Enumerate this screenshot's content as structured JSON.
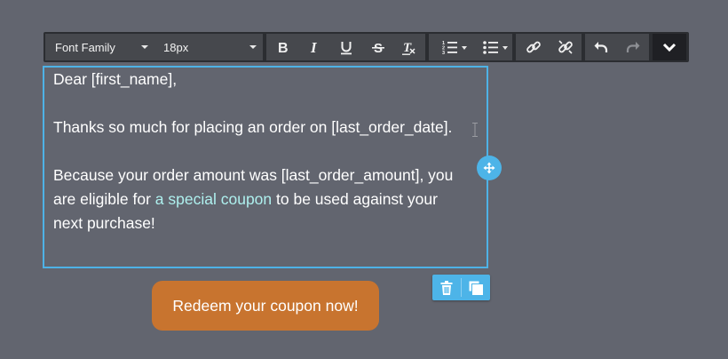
{
  "toolbar": {
    "font_family_label": "Font Family",
    "font_size_label": "18px",
    "buttons": [
      "bold-icon",
      "italic-icon",
      "underline-icon",
      "strikethrough-icon",
      "clear-format-icon",
      "ordered-list-icon",
      "unordered-list-icon",
      "link-icon",
      "unlink-icon",
      "undo-icon",
      "redo-icon",
      "chevron-down-icon"
    ]
  },
  "editor": {
    "line1": "Dear [first_name],",
    "line2": "Thanks so much for placing an order on [last_order_date].",
    "para3_line1": "Because your order amount was [last_order_amount], you",
    "para3_line2_before": "are eligible for ",
    "para3_link": "a special coupon",
    "para3_line2_after": " to be used against your",
    "para3_line3": "next purchase!"
  },
  "button": {
    "label": "Redeem your coupon now!"
  },
  "colors": {
    "background": "#62656f",
    "toolbar": "#2b2d31",
    "selection_border": "#4eb2e6",
    "link": "#aef0ee",
    "cta": "#c8742f"
  }
}
